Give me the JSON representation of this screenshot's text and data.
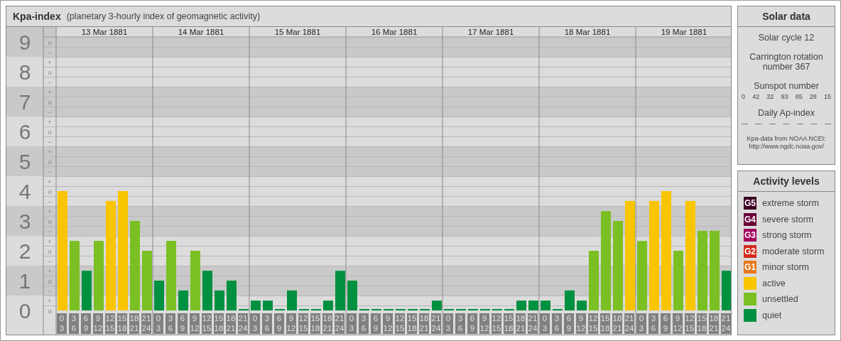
{
  "title": "Kpa-index",
  "subtitle": "(planetary 3-hourly index of geomagnetic activity)",
  "sub_ticks": [
    "o",
    "−",
    "+",
    "o",
    "−",
    "+",
    "o",
    "−",
    "+",
    "o",
    "−",
    "+",
    "o",
    "−",
    "+",
    "o",
    "−",
    "+",
    "o",
    "−",
    "+",
    "o",
    "−",
    "+",
    "o",
    "−",
    "+",
    "o"
  ],
  "days": [
    "13 Mar 1881",
    "14 Mar 1881",
    "15 Mar 1881",
    "16 Mar 1881",
    "17 Mar 1881",
    "18 Mar 1881",
    "19 Mar 1881"
  ],
  "chart_data": {
    "type": "bar",
    "ylim": [
      0,
      9
    ],
    "yticks": [
      0,
      1,
      2,
      3,
      4,
      5,
      6,
      7,
      8,
      9
    ],
    "grid": true,
    "categories": [
      "0 3",
      "3 6",
      "6 9",
      "9 12",
      "12 15",
      "15 18",
      "18 21",
      "21 24",
      "0 3",
      "3 6",
      "6 9",
      "9 12",
      "12 15",
      "15 18",
      "18 21",
      "21 24",
      "0 3",
      "3 6",
      "6 9",
      "9 12",
      "12 15",
      "15 18",
      "18 21",
      "21 24",
      "0 3",
      "3 6",
      "6 9",
      "9 12",
      "12 15",
      "15 18",
      "18 21",
      "21 24",
      "0 3",
      "3 6",
      "6 9",
      "9 12",
      "12 15",
      "15 18",
      "18 21",
      "21 24",
      "0 3",
      "3 6",
      "6 9",
      "9 12",
      "12 15",
      "15 18",
      "18 21",
      "21 24",
      "0 3",
      "3 6",
      "6 9",
      "9 12",
      "12 15",
      "15 18",
      "18 21",
      "21 24"
    ],
    "values": [
      4,
      2.33,
      1.33,
      2.33,
      3.67,
      4,
      3,
      2,
      1,
      2.33,
      0.67,
      2,
      1.33,
      0.67,
      1,
      0,
      0.33,
      0.33,
      0,
      0.67,
      0,
      0,
      0.33,
      1.33,
      1,
      0,
      0,
      0,
      0,
      0,
      0,
      0.33,
      0,
      0,
      0,
      0,
      0,
      0,
      0.33,
      0.33,
      0.33,
      0,
      0.67,
      0.33,
      2,
      3.33,
      3,
      3.67,
      2.33,
      3.67,
      4,
      2,
      3.67,
      2.67,
      2.67,
      1.33
    ]
  },
  "solar": {
    "title": "Solar data",
    "cycle": "Solar cycle 12",
    "rotation": "Carrington rotation number 367",
    "sunspot_label": "Sunspot number",
    "sunspots": [
      "0",
      "42",
      "32",
      "93",
      "85",
      "28",
      "15"
    ],
    "ap_label": "Daily Ap-index",
    "ap": [
      "—",
      "—",
      "—",
      "—",
      "—",
      "—",
      "—"
    ],
    "source": "Kpa-data from NOAA NCEI: http://www.ngdc.noaa.gov/"
  },
  "legend": {
    "title": "Activity levels",
    "items": [
      {
        "badge": "G5",
        "label": "extreme storm",
        "color": "#3e0022"
      },
      {
        "badge": "G4",
        "label": "severe storm",
        "color": "#6a0038"
      },
      {
        "badge": "G3",
        "label": "strong storm",
        "color": "#a3005c"
      },
      {
        "badge": "G2",
        "label": "moderate storm",
        "color": "#d42a1c"
      },
      {
        "badge": "G1",
        "label": "minor storm",
        "color": "#e8781a"
      },
      {
        "label": "active",
        "color": "#f8c500"
      },
      {
        "label": "unsettled",
        "color": "#7ac022"
      },
      {
        "label": "quiet",
        "color": "#009140"
      }
    ]
  }
}
